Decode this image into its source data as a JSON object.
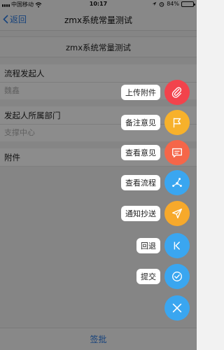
{
  "status": {
    "carrier": "中国移动",
    "time": "10:17",
    "battery": "84%",
    "battery_level": 0.84
  },
  "nav": {
    "back_label": "返回",
    "title": "zmx系统常量测试"
  },
  "page": {
    "subheader": "zmx系统常量测试",
    "fields": [
      {
        "label": "流程发起人",
        "value": "魏鑫"
      },
      {
        "label": "发起人所属部门",
        "value": "支撑中心"
      },
      {
        "label": "附件",
        "value": ""
      }
    ]
  },
  "bottom": {
    "action_label": "签批"
  },
  "fab_menu": [
    {
      "label": "上传附件",
      "icon": "paperclip-icon",
      "color": "#f2434c"
    },
    {
      "label": "备注意见",
      "icon": "flag-icon",
      "color": "#f7b12b"
    },
    {
      "label": "查看意见",
      "icon": "comment-icon",
      "color": "#f56649"
    },
    {
      "label": "查看流程",
      "icon": "flow-icon",
      "color": "#3aa6f0"
    },
    {
      "label": "通知抄送",
      "icon": "send-icon",
      "color": "#f7a92b"
    },
    {
      "label": "回退",
      "icon": "back-icon",
      "color": "#3aa6f0"
    },
    {
      "label": "提交",
      "icon": "check-icon",
      "color": "#3aa6f0"
    }
  ],
  "close": {
    "icon": "close-icon",
    "color": "#3aa6f0"
  }
}
